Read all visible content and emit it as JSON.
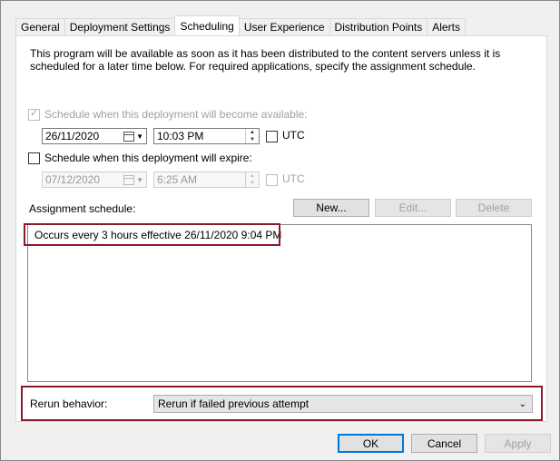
{
  "tabs": [
    {
      "label": "General",
      "active": false
    },
    {
      "label": "Deployment Settings",
      "active": false
    },
    {
      "label": "Scheduling",
      "active": true
    },
    {
      "label": "User Experience",
      "active": false
    },
    {
      "label": "Distribution Points",
      "active": false
    },
    {
      "label": "Alerts",
      "active": false
    }
  ],
  "description": "This program will be available as soon as it has been distributed to the content servers unless it is scheduled for a later time below. For required applications, specify the assignment schedule.",
  "available": {
    "checkbox_label": "Schedule when this deployment will become available:",
    "checked": true,
    "date": "26/11/2020",
    "time": "10:03 PM",
    "utc_label": "UTC"
  },
  "expire": {
    "checkbox_label": "Schedule when this deployment will expire:",
    "checked": false,
    "date": "07/12/2020",
    "time": "6:25 AM",
    "utc_label": "UTC"
  },
  "assignment": {
    "label": "Assignment schedule:",
    "new_label": "New...",
    "edit_label": "Edit...",
    "delete_label": "Delete",
    "items": [
      "Occurs every 3 hours effective 26/11/2020 9:04 PM"
    ]
  },
  "rerun": {
    "label": "Rerun behavior:",
    "value": "Rerun if failed previous attempt"
  },
  "footer": {
    "ok_label": "OK",
    "cancel_label": "Cancel",
    "apply_label": "Apply"
  },
  "colors": {
    "highlight": "#8b1a2b",
    "focus": "#0078d7"
  }
}
